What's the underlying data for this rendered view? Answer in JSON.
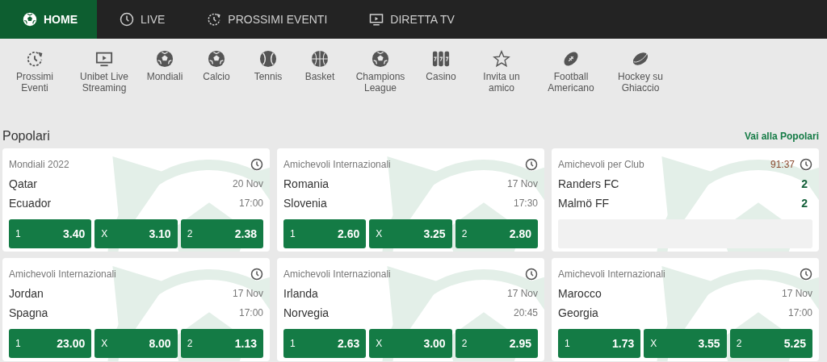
{
  "nav": [
    {
      "label": "HOME",
      "kind": "ball",
      "selected": true
    },
    {
      "label": "LIVE",
      "kind": "clock",
      "selected": false
    },
    {
      "label": "PROSSIMI EVENTI",
      "kind": "upcoming",
      "selected": false
    },
    {
      "label": "DIRETTA TV",
      "kind": "tv",
      "selected": false
    }
  ],
  "sports": [
    {
      "label": "Prossimi Eventi",
      "kind": "upcoming"
    },
    {
      "label": "Unibet Live Streaming",
      "kind": "tv"
    },
    {
      "label": "Mondiali",
      "kind": "ball"
    },
    {
      "label": "Calcio",
      "kind": "ball"
    },
    {
      "label": "Tennis",
      "kind": "tennis"
    },
    {
      "label": "Basket",
      "kind": "basket"
    },
    {
      "label": "Champions League",
      "kind": "ball"
    },
    {
      "label": "Casino",
      "kind": "slot"
    },
    {
      "label": "Invita un amico",
      "kind": "star"
    },
    {
      "label": "Football Americano",
      "kind": "football"
    },
    {
      "label": "Hockey su Ghiaccio",
      "kind": "puck"
    }
  ],
  "section": {
    "title": "Popolari",
    "link": "Vai alla Popolari"
  },
  "events": [
    {
      "kind": "prematch",
      "league": "Mondiali 2022",
      "home": "Qatar",
      "away": "Ecuador",
      "date": "20 Nov",
      "time": "17:00",
      "odds": [
        {
          "label": "1",
          "value": "3.40"
        },
        {
          "label": "X",
          "value": "3.10"
        },
        {
          "label": "2",
          "value": "2.38"
        }
      ]
    },
    {
      "kind": "prematch",
      "league": "Amichevoli Internazionali",
      "home": "Romania",
      "away": "Slovenia",
      "date": "17 Nov",
      "time": "17:30",
      "odds": [
        {
          "label": "1",
          "value": "2.60"
        },
        {
          "label": "X",
          "value": "3.25"
        },
        {
          "label": "2",
          "value": "2.80"
        }
      ]
    },
    {
      "kind": "live",
      "league": "Amichevoli per Club",
      "clock": "91:37",
      "home": "Randers FC",
      "away": "Malmö FF",
      "home_score": "2",
      "away_score": "2"
    },
    {
      "kind": "prematch",
      "league": "Amichevoli Internazionali",
      "home": "Jordan",
      "away": "Spagna",
      "date": "17 Nov",
      "time": "17:00",
      "odds": [
        {
          "label": "1",
          "value": "23.00"
        },
        {
          "label": "X",
          "value": "8.00"
        },
        {
          "label": "2",
          "value": "1.13"
        }
      ]
    },
    {
      "kind": "prematch",
      "league": "Amichevoli Internazionali",
      "home": "Irlanda",
      "away": "Norvegia",
      "date": "17 Nov",
      "time": "20:45",
      "odds": [
        {
          "label": "1",
          "value": "2.63"
        },
        {
          "label": "X",
          "value": "3.00"
        },
        {
          "label": "2",
          "value": "2.95"
        }
      ]
    },
    {
      "kind": "prematch",
      "league": "Amichevoli Internazionali",
      "home": "Marocco",
      "away": "Georgia",
      "date": "17 Nov",
      "time": "17:00",
      "odds": [
        {
          "label": "1",
          "value": "1.73"
        },
        {
          "label": "X",
          "value": "3.55"
        },
        {
          "label": "2",
          "value": "5.25"
        }
      ]
    }
  ]
}
